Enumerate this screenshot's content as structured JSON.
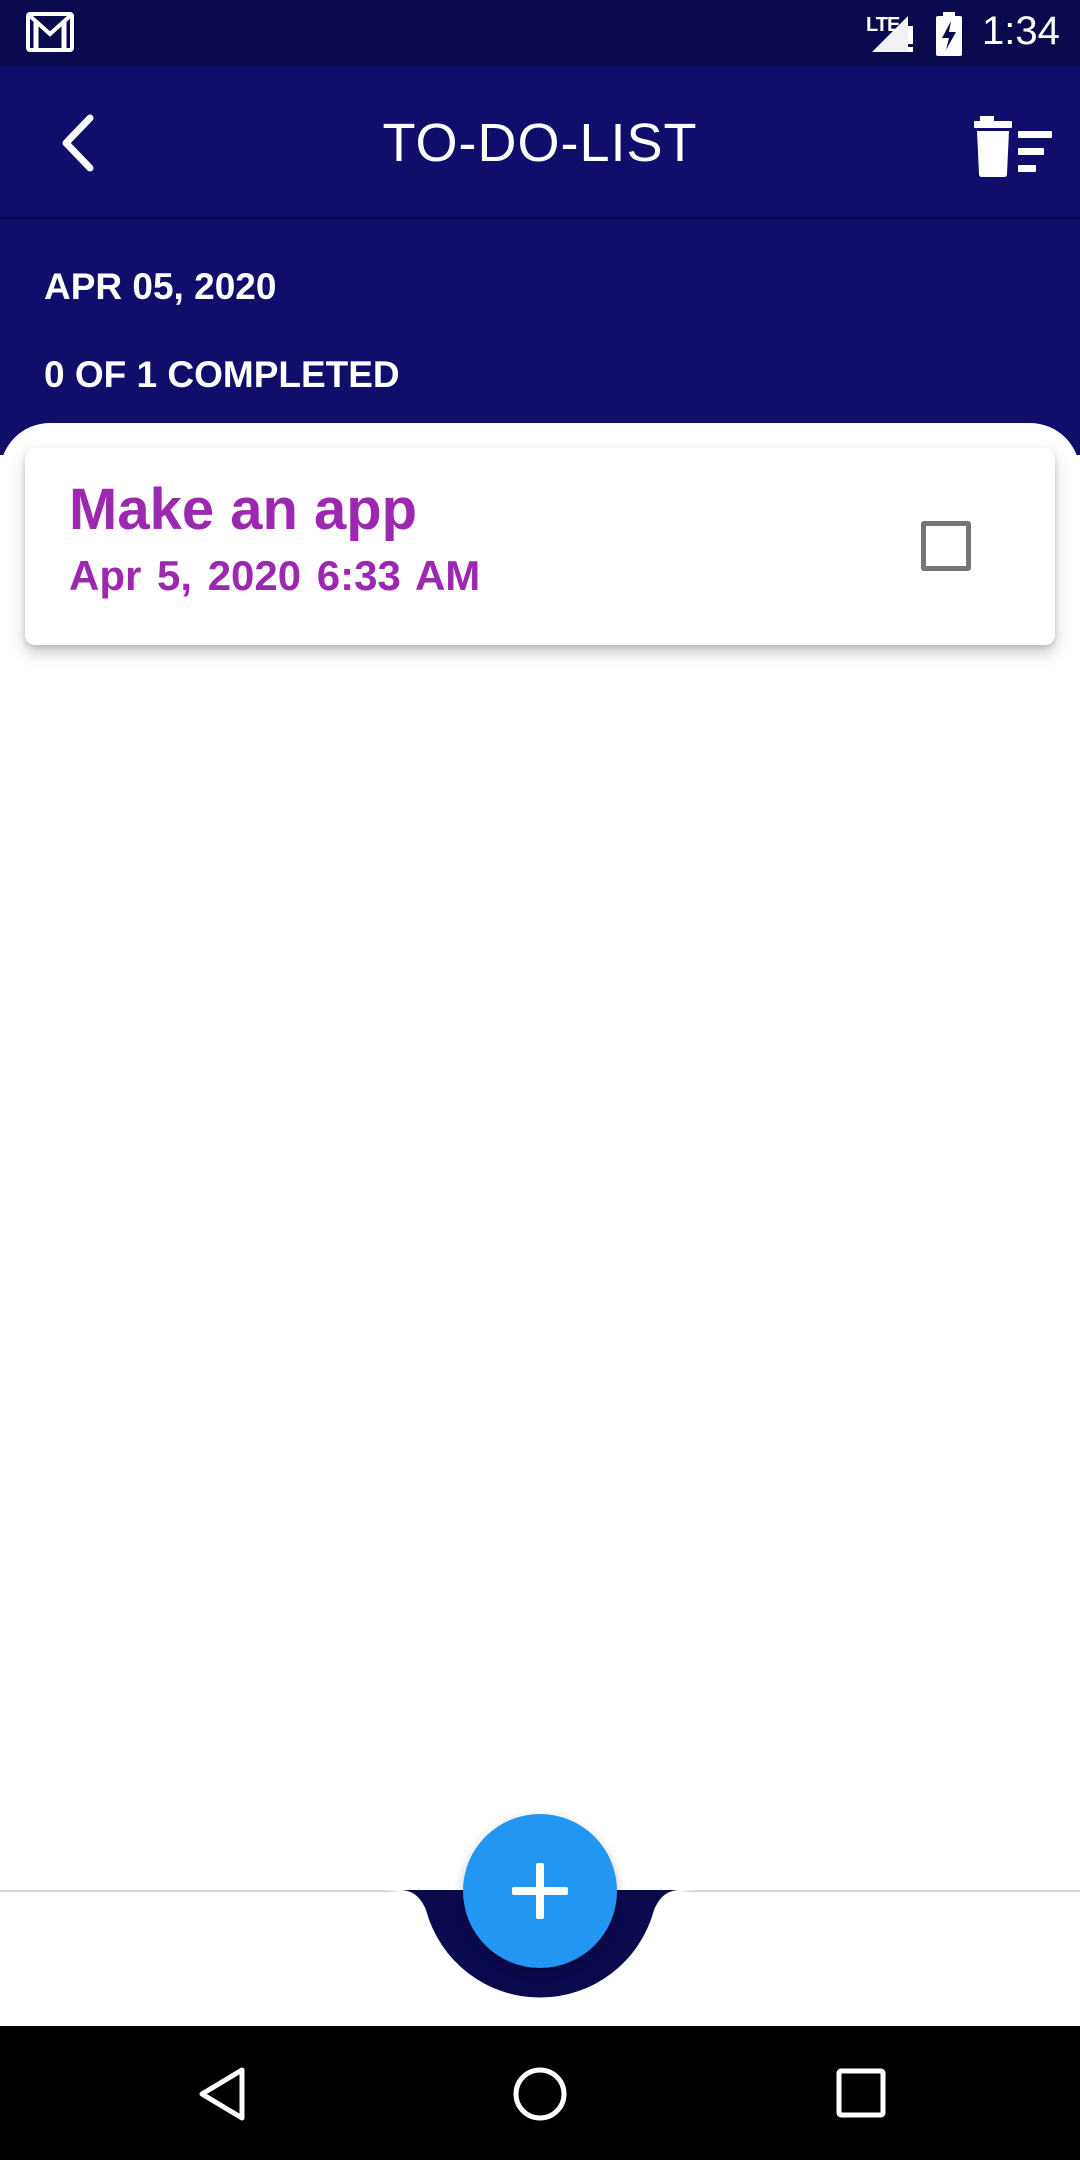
{
  "status_bar": {
    "time": "1:34",
    "network": "LTE",
    "icons": [
      "gmail-icon",
      "signal-icon",
      "battery-charging-icon"
    ]
  },
  "app_bar": {
    "title": "TO-DO-LIST",
    "back_icon": "chevron-left-icon",
    "action_icon": "delete-sweep-icon"
  },
  "summary": {
    "date": "APR 05, 2020",
    "progress": "0 OF 1 COMPLETED"
  },
  "tasks": [
    {
      "title": "Make an app",
      "datetime": "Apr 5, 2020  6:33 AM",
      "completed": false
    }
  ],
  "fab": {
    "icon": "plus-icon"
  },
  "nav_bar": {
    "icons": [
      "nav-back-icon",
      "nav-home-icon",
      "nav-recents-icon"
    ]
  },
  "colors": {
    "status_bar": "#0c0a4f",
    "app_bar": "#100d6b",
    "task_text": "#9c27b0",
    "fab": "#2196f3"
  }
}
